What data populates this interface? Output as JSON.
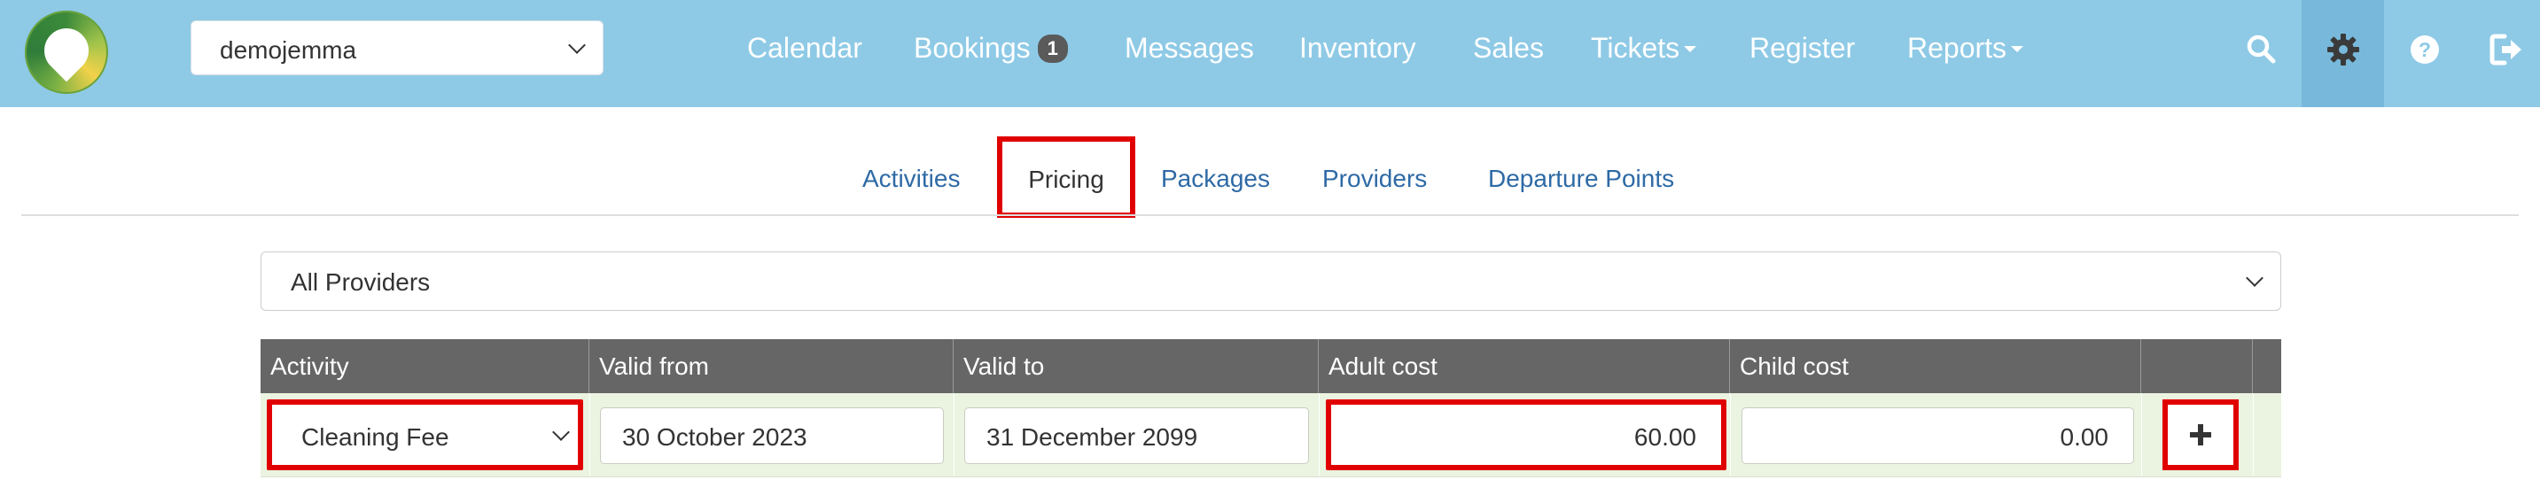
{
  "navbar": {
    "account": "demojemma",
    "items": [
      {
        "label": "Calendar"
      },
      {
        "label": "Bookings",
        "badge": "1"
      },
      {
        "label": "Messages"
      },
      {
        "label": "Inventory"
      },
      {
        "label": "Sales"
      },
      {
        "label": "Tickets",
        "dropdown": true
      },
      {
        "label": "Register"
      },
      {
        "label": "Reports",
        "dropdown": true
      }
    ],
    "icons": [
      "search-icon",
      "gear-icon",
      "help-icon",
      "logout-icon"
    ],
    "active_icon": "gear-icon"
  },
  "tabs": {
    "items": [
      "Activities",
      "Pricing",
      "Packages",
      "Providers",
      "Departure Points"
    ],
    "active": "Pricing"
  },
  "filter": {
    "provider": "All Providers"
  },
  "table": {
    "headers": [
      "Activity",
      "Valid from",
      "Valid to",
      "Adult cost",
      "Child cost"
    ],
    "row": {
      "activity": "Cleaning Fee",
      "valid_from": "30 October 2023",
      "valid_to": "31 December 2099",
      "adult_cost": "60.00",
      "child_cost": "0.00"
    },
    "add_label": "+"
  },
  "colors": {
    "navbar_bg": "#8ecae6",
    "active_icon_bg": "#78b9db",
    "link": "#2e6aa5",
    "table_header": "#666666",
    "row_bg": "#eaf4e0",
    "highlight": "#e00000"
  }
}
